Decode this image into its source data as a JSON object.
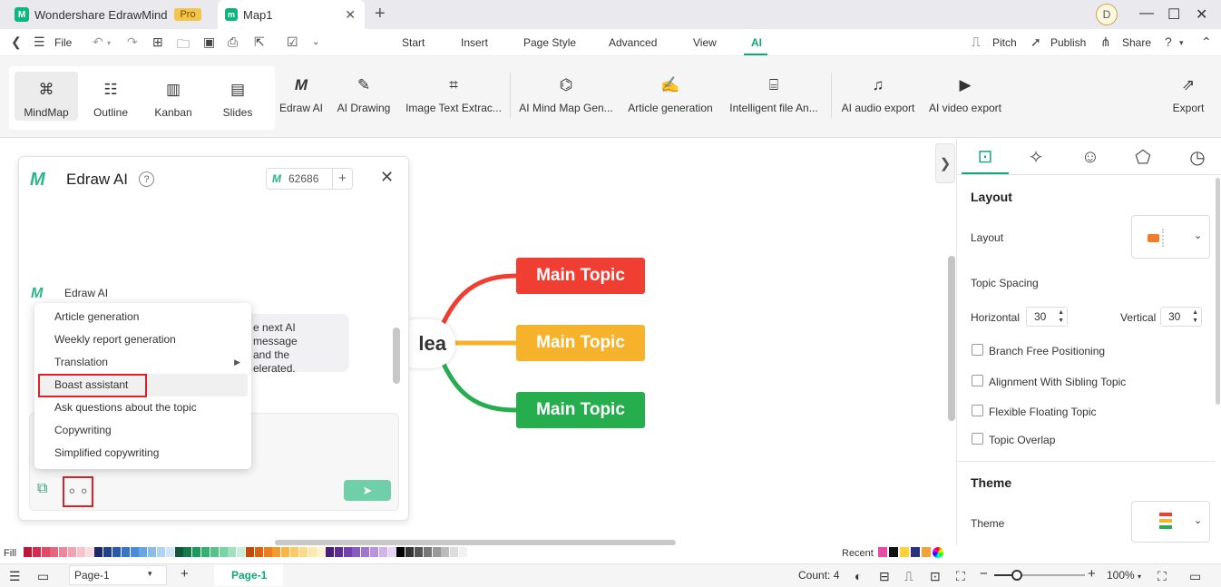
{
  "titlebar": {
    "app_name": "Wondershare EdrawMind",
    "pro_badge": "Pro",
    "doc_tab": "Map1",
    "avatar_letter": "D"
  },
  "menubar": {
    "file": "File",
    "tabs": [
      "Start",
      "Insert",
      "Page Style",
      "Advanced",
      "View",
      "AI"
    ],
    "active_tab": "AI",
    "right": [
      "Pitch",
      "Publish",
      "Share"
    ]
  },
  "ribbon": {
    "views": [
      "MindMap",
      "Outline",
      "Kanban",
      "Slides"
    ],
    "tools": [
      "Edraw AI",
      "AI Drawing",
      "Image Text Extrac...",
      "AI Mind Map Gen...",
      "Article generation",
      "Intelligent file An...",
      "AI audio export",
      "AI video export",
      "Export"
    ]
  },
  "canvas": {
    "central_text": "lea",
    "topics": [
      {
        "label": "Main Topic",
        "color": "#f03e33"
      },
      {
        "label": "Main Topic",
        "color": "#f5b22a"
      },
      {
        "label": "Main Topic",
        "color": "#26ad4e"
      }
    ]
  },
  "ai_panel": {
    "title": "Edraw AI",
    "credits": "62686",
    "bot_name": "Edraw AI",
    "bubble_lines": [
      "e next AI message",
      "and the",
      "elerated."
    ],
    "menu_items": [
      {
        "label": "Article generation"
      },
      {
        "label": "Weekly report generation"
      },
      {
        "label": "Translation",
        "submenu": true
      },
      {
        "label": "Boast assistant",
        "highlighted": true
      },
      {
        "label": "Ask questions about the topic"
      },
      {
        "label": "Copywriting"
      },
      {
        "label": "Simplified copywriting"
      }
    ]
  },
  "right_panel": {
    "layout_heading": "Layout",
    "layout_label": "Layout",
    "topic_spacing": "Topic Spacing",
    "horizontal_label": "Horizontal",
    "horizontal_value": "30",
    "vertical_label": "Vertical",
    "vertical_value": "30",
    "checkboxes": [
      "Branch Free Positioning",
      "Alignment With Sibling Topic",
      "Flexible Floating Topic",
      "Topic Overlap"
    ],
    "theme_heading": "Theme",
    "theme_label": "Theme"
  },
  "colorbar": {
    "fill_label": "Fill",
    "recent_label": "Recent"
  },
  "statusbar": {
    "page_select": "Page-1",
    "page_tab": "Page-1",
    "count": "Count: 4",
    "zoom": "100%"
  },
  "accent_color": "#0fa877"
}
